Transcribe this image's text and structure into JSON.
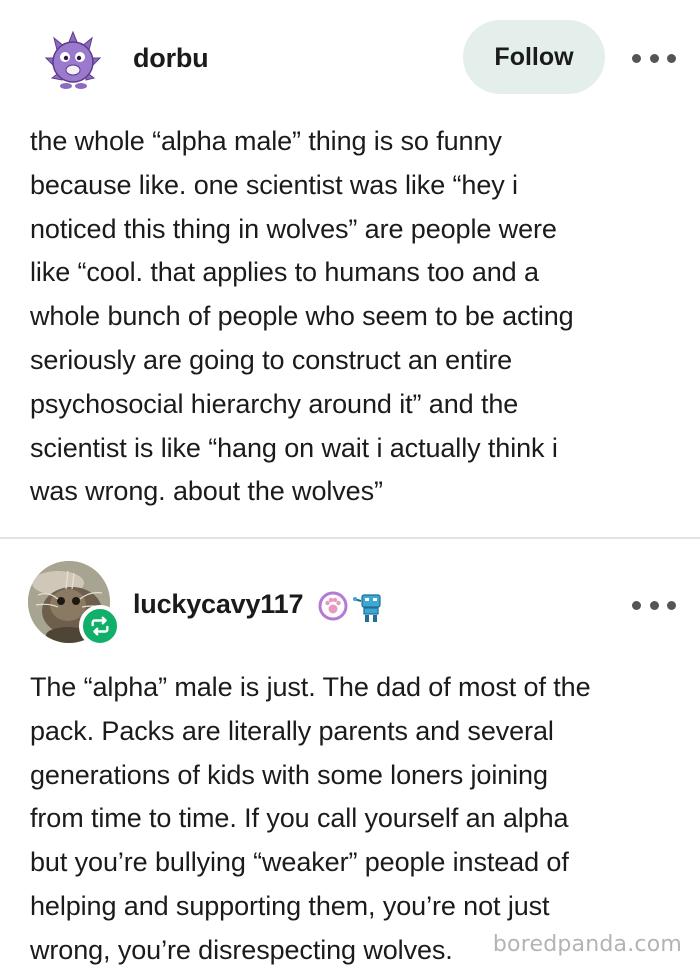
{
  "posts": [
    {
      "username": "dorbu",
      "follow_label": "Follow",
      "text": "the whole “alpha male” thing is so funny\nbecause like. one scientist was like “hey i\nnoticed this thing in wolves” are people were\nlike “cool. that applies to humans too and a\nwhole bunch of people who seem to be acting\nseriously are going to construct an entire\npsychosocial hierarchy around it” and the\nscientist is like “hang on wait i actually think i\nwas wrong. about the wolves”"
    },
    {
      "username": "luckycavy117",
      "text": "The “alpha” male is just. The dad of most of the\npack.  Packs are literally parents and several\ngenerations of kids with some loners joining\nfrom time to time. If you call yourself an alpha\nbut you’re bullying “weaker” people instead of\nhelping and supporting them, you’re not just\nwrong, you’re disrespecting wolves."
    }
  ],
  "watermark": "boredpanda.com",
  "icons": {
    "avatar1": "purple-monster-avatar-icon",
    "avatar2": "cat-photo-avatar-icon",
    "reblog": "reblog-icon",
    "badge1": "paw-badge-icon",
    "badge2": "robot-badge-icon",
    "more": "more-options-icon"
  },
  "colors": {
    "follow_bg": "#e4efec",
    "reblog_green": "#10b06a",
    "divider": "#e2e2e2",
    "watermark": "#b4b4b4"
  }
}
